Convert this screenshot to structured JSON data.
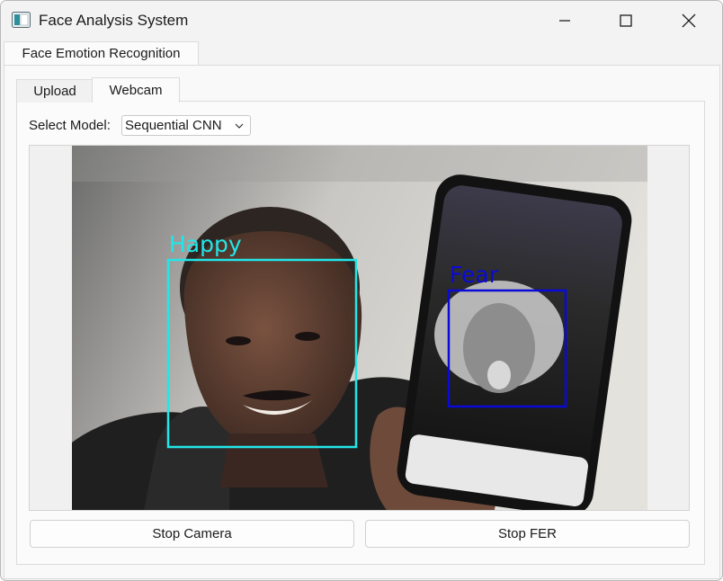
{
  "window": {
    "title": "Face Analysis System"
  },
  "outer_tabs": [
    {
      "label": "Face Emotion Recognition",
      "active": true
    }
  ],
  "inner_tabs": [
    {
      "label": "Upload",
      "active": false
    },
    {
      "label": "Webcam",
      "active": true
    }
  ],
  "model_select": {
    "label": "Select Model:",
    "value": "Sequential CNN"
  },
  "detections": [
    {
      "label": "Happy",
      "color": "#22e6e8"
    },
    {
      "label": "Fear",
      "color": "#0a0ad8"
    }
  ],
  "buttons": {
    "stop_camera": "Stop Camera",
    "stop_fer": "Stop FER"
  },
  "colors": {
    "window_bg": "#f3f3f3",
    "happy_box": "#22e6e8",
    "fear_box": "#0a0ad8"
  }
}
